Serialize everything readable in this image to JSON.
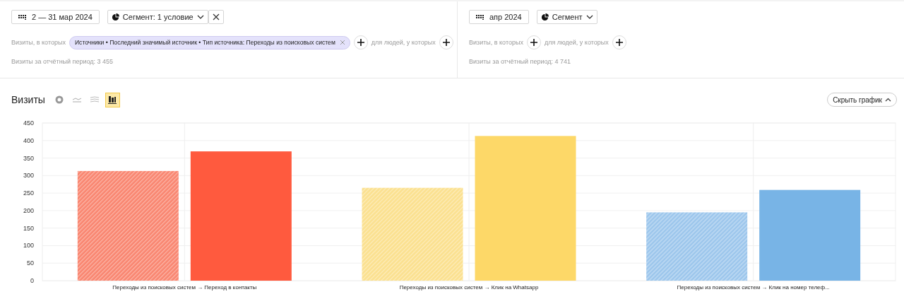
{
  "segments": [
    {
      "period": "2 — 31 мар 2024",
      "segment_button": "Сегмент: 1 условие",
      "removable": true,
      "visits_label": "Визиты, в которых",
      "filters": [
        "Источники • Последний значимый источник • Тип источника: Переходы из поисковых систем"
      ],
      "people_label": "для людей, у которых",
      "total": "Визиты за отчётный период: 3 455"
    },
    {
      "period": "апр 2024",
      "segment_button": "Сегмент",
      "visits_label": "Визиты, в которых",
      "people_label": "для людей, у которых",
      "total": "Визиты за отчётный период: 4 741"
    }
  ],
  "chart_section": {
    "title": "Визиты",
    "chart_types": [
      {
        "kind": "pie",
        "selected": false
      },
      {
        "kind": "line",
        "selected": false
      },
      {
        "kind": "stacked",
        "selected": false
      },
      {
        "kind": "bar",
        "selected": true
      }
    ],
    "hide_button": "Скрыть график",
    "chart_data": {
      "type": "bar",
      "categories": [
        "Переходы из поисковых систем → Переход в контакты",
        "Переходы из поисковых систем → Клик на Whatsapp",
        "Переходы из поисковых систем → Клик на номер телеф..."
      ],
      "grid": true,
      "series": [
        {
          "colors": [
            "#f9856f",
            "#fbe08e",
            "#9cc6ec"
          ],
          "values": [
            313,
            265,
            195
          ]
        },
        {
          "colors": [
            "#ff5a3e",
            "#fdd868",
            "#78b4e6"
          ],
          "values": [
            369,
            413,
            259
          ]
        }
      ],
      "ylim": [
        0,
        450
      ],
      "yticks": [
        0,
        50,
        100,
        150,
        200,
        250,
        300,
        350,
        400,
        450
      ]
    }
  }
}
